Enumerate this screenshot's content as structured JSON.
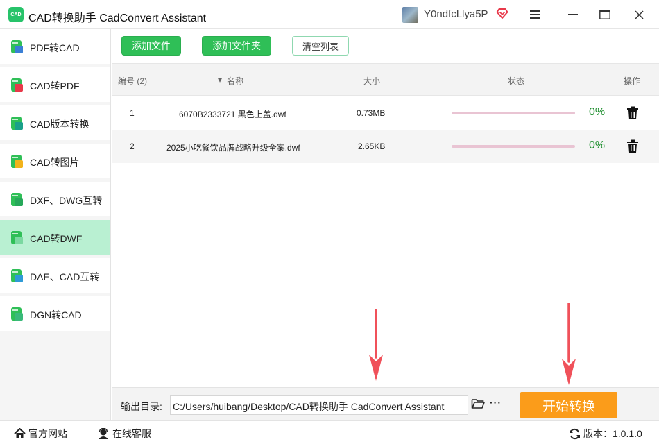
{
  "titlebar": {
    "logo_text": "CAD",
    "title": "CAD转换助手 CadConvert Assistant",
    "username": "Y0ndfcLlya5P",
    "icons": [
      "vip-heart-icon",
      "menu-icon",
      "minimize-icon",
      "maximize-icon",
      "close-icon"
    ]
  },
  "sidebar": {
    "items": [
      {
        "label": "PDF转CAD",
        "active": false
      },
      {
        "label": "CAD转PDF",
        "active": false
      },
      {
        "label": "CAD版本转换",
        "active": false
      },
      {
        "label": "CAD转图片",
        "active": false
      },
      {
        "label": "DXF、DWG互转",
        "active": false
      },
      {
        "label": "CAD转DWF",
        "active": true
      },
      {
        "label": "DAE、CAD互转",
        "active": false
      },
      {
        "label": "DGN转CAD",
        "active": false
      }
    ]
  },
  "toolbar": {
    "add_file": "添加文件",
    "add_folder": "添加文件夹",
    "clear_list": "清空列表"
  },
  "table": {
    "headers": {
      "index": "编号 (2)",
      "name": "名称",
      "size": "大小",
      "status": "状态",
      "action": "操作"
    },
    "rows": [
      {
        "index": "1",
        "name": "6070B2333721 黑色上盖.dwf",
        "size": "0.73MB",
        "progress": 0,
        "percent": "0%"
      },
      {
        "index": "2",
        "name": "2025小吃餐饮品牌战略升级全案.dwf",
        "size": "2.65KB",
        "progress": 0,
        "percent": "0%"
      }
    ]
  },
  "output": {
    "label": "输出目录:",
    "path": "C:/Users/huibang/Desktop/CAD转换助手 CadConvert Assistant",
    "more": "···",
    "start_button": "开始转换"
  },
  "statusbar": {
    "website": "官方网站",
    "support": "在线客服",
    "version": "版本：1.0.1.0"
  },
  "colors": {
    "accent_green": "#2fbf57",
    "active_sidebar": "#b9f0d2",
    "start_orange": "#fb9c1a",
    "progress_track": "#e9c4d3",
    "arrow_red": "#f0515a"
  }
}
